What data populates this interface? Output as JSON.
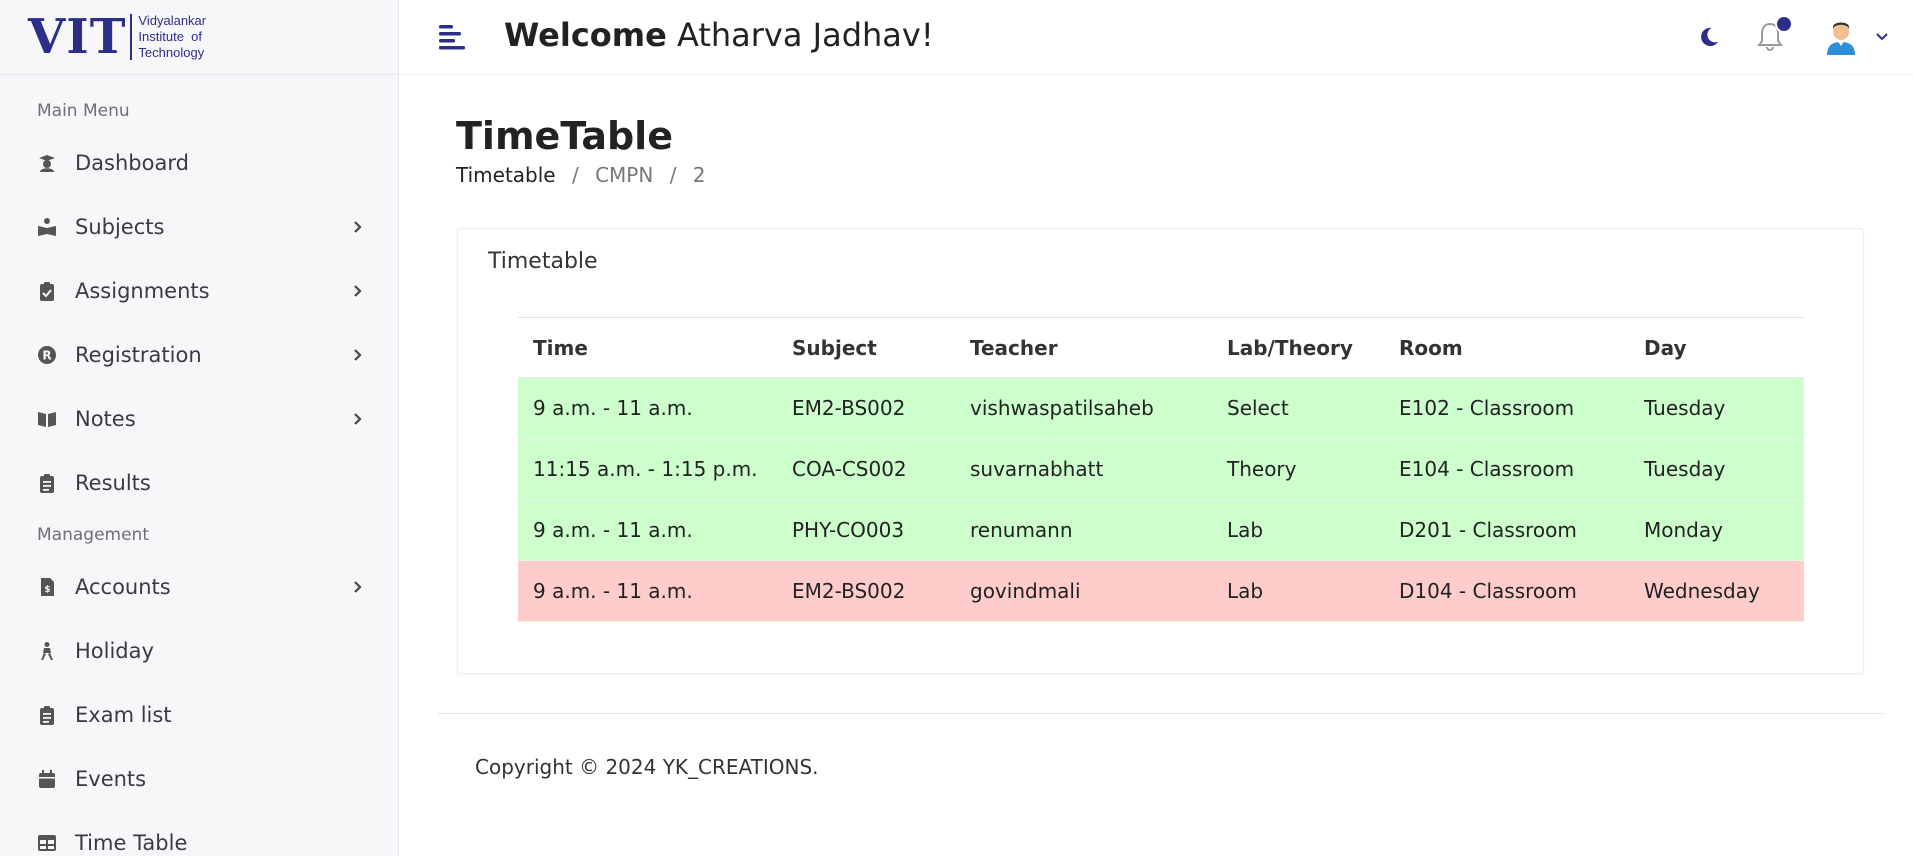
{
  "logo": {
    "vit": "VIT",
    "line1": "Vidyalankar",
    "line2": "Institute  of",
    "line3": "Technology"
  },
  "sidebar": {
    "sections": [
      {
        "title": "Main Menu",
        "items": [
          {
            "label": "Dashboard",
            "icon": "graduate-icon",
            "has_submenu": false
          },
          {
            "label": "Subjects",
            "icon": "book-reader-icon",
            "has_submenu": true
          },
          {
            "label": "Assignments",
            "icon": "clipboard-check-icon",
            "has_submenu": true
          },
          {
            "label": "Registration",
            "icon": "registered-icon",
            "has_submenu": true
          },
          {
            "label": "Notes",
            "icon": "open-book-icon",
            "has_submenu": true
          },
          {
            "label": "Results",
            "icon": "clipboard-list-icon",
            "has_submenu": false
          }
        ]
      },
      {
        "title": "Management",
        "items": [
          {
            "label": "Accounts",
            "icon": "invoice-icon",
            "has_submenu": true
          },
          {
            "label": "Holiday",
            "icon": "holiday-icon",
            "has_submenu": false
          },
          {
            "label": "Exam list",
            "icon": "clipboard-list-icon",
            "has_submenu": false
          },
          {
            "label": "Events",
            "icon": "calendar-icon",
            "has_submenu": false
          },
          {
            "label": "Time Table",
            "icon": "table-icon",
            "has_submenu": false
          }
        ]
      }
    ]
  },
  "header": {
    "welcome_bold": "Welcome",
    "welcome_name": "Atharva Jadhav!",
    "accent_color": "#2c2f8a"
  },
  "page": {
    "title": "TimeTable",
    "breadcrumb": [
      "Timetable",
      "CMPN",
      "2"
    ]
  },
  "card": {
    "title": "Timetable",
    "columns": [
      "Time",
      "Subject",
      "Teacher",
      "Lab/Theory",
      "Room",
      "Day"
    ],
    "rows": [
      {
        "status": "green",
        "cells": [
          "9 a.m. - 11 a.m.",
          "EM2-BS002",
          "vishwaspatilsaheb",
          "Select",
          "E102 - Classroom",
          "Tuesday"
        ]
      },
      {
        "status": "green",
        "cells": [
          "11:15 a.m. - 1:15 p.m.",
          "COA-CS002",
          "suvarnabhatt",
          "Theory",
          "E104 - Classroom",
          "Tuesday"
        ]
      },
      {
        "status": "green",
        "cells": [
          "9 a.m. - 11 a.m.",
          "PHY-CO003",
          "renumann",
          "Lab",
          "D201 - Classroom",
          "Monday"
        ]
      },
      {
        "status": "red",
        "cells": [
          "9 a.m. - 11 a.m.",
          "EM2-BS002",
          "govindmali",
          "Lab",
          "D104 - Classroom",
          "Wednesday"
        ]
      }
    ],
    "row_colors": {
      "green": "#ccffcc",
      "red": "#ffcccc"
    }
  },
  "footer": {
    "copyright": "Copyright © 2024 YK_CREATIONS."
  }
}
